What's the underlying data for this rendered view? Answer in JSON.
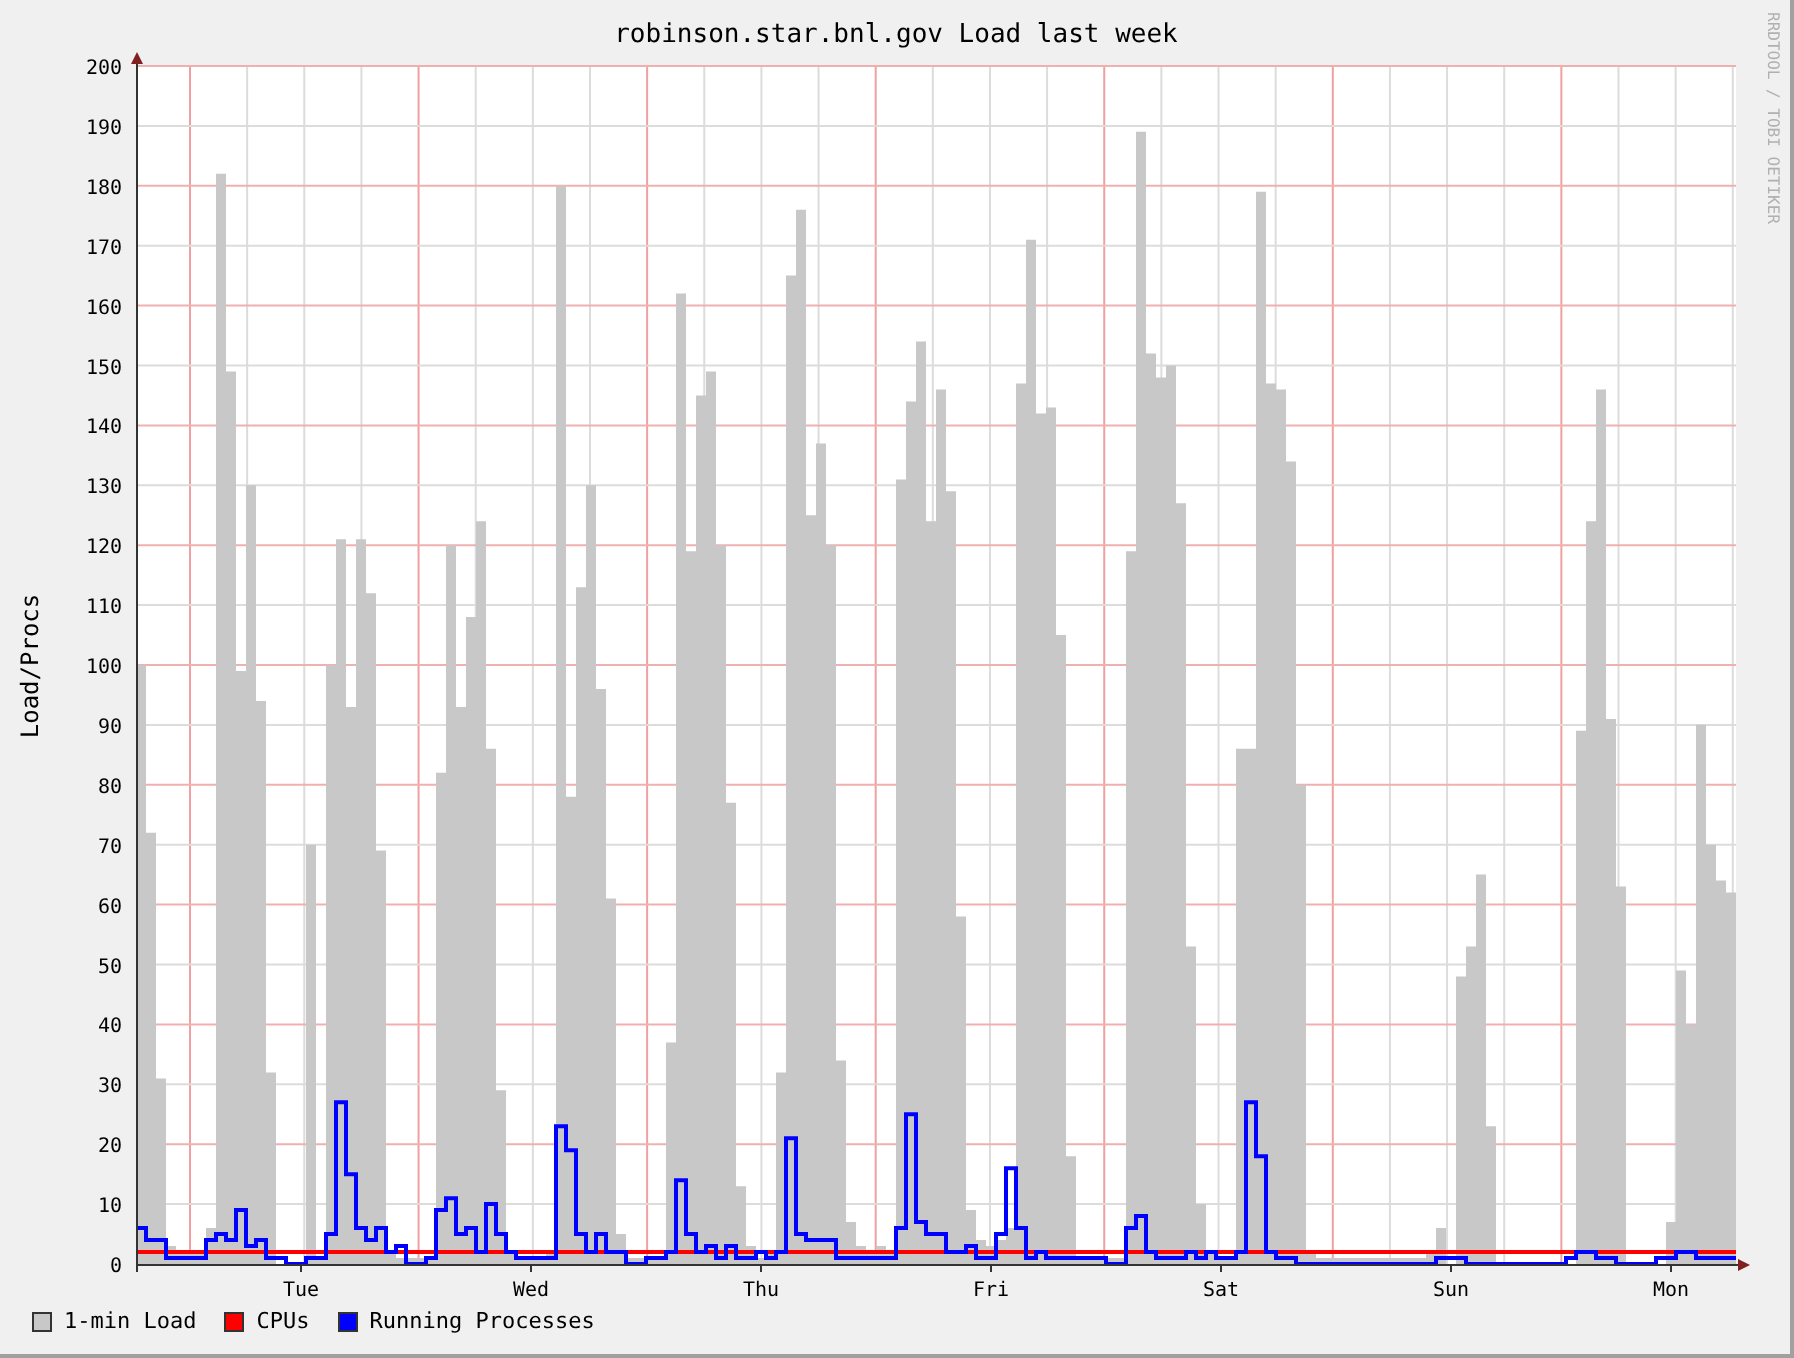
{
  "chart_data": {
    "type": "area",
    "title": "robinson.star.bnl.gov Load last week",
    "ylabel": "Load/Procs",
    "grid": true,
    "categories": [
      null,
      null,
      null,
      null,
      null,
      null,
      null,
      null,
      null,
      null,
      null,
      null,
      null,
      null,
      null,
      null,
      "Tue",
      null,
      null,
      null,
      null,
      null,
      null,
      null,
      null,
      null,
      null,
      null,
      null,
      null,
      null,
      null,
      null,
      null,
      null,
      null,
      null,
      null,
      null,
      "Wed",
      null,
      null,
      null,
      null,
      null,
      null,
      null,
      null,
      null,
      null,
      null,
      null,
      null,
      null,
      null,
      null,
      null,
      null,
      null,
      null,
      null,
      null,
      "Thu",
      null,
      null,
      null,
      null,
      null,
      null,
      null,
      null,
      null,
      null,
      null,
      null,
      null,
      null,
      null,
      null,
      null,
      null,
      null,
      null,
      null,
      null,
      "Fri",
      null,
      null,
      null,
      null,
      null,
      null,
      null,
      null,
      null,
      null,
      null,
      null,
      null,
      null,
      null,
      null,
      null,
      null,
      null,
      null,
      null,
      null,
      "Sat",
      null,
      null,
      null,
      null,
      null,
      null,
      null,
      null,
      null,
      null,
      null,
      null,
      null,
      null,
      null,
      null,
      null,
      null,
      null,
      null,
      null,
      null,
      "Sun",
      null,
      null,
      null,
      null,
      null,
      null,
      null,
      null,
      null,
      null,
      null,
      null,
      null,
      null,
      null,
      null,
      null,
      null,
      null,
      null,
      null,
      "Mon",
      null,
      null,
      null,
      null,
      null,
      null
    ],
    "ylim": [
      0,
      200
    ],
    "yticks": [
      0,
      10,
      20,
      30,
      40,
      50,
      60,
      70,
      80,
      90,
      100,
      110,
      120,
      130,
      140,
      150,
      160,
      170,
      180,
      190,
      200
    ],
    "series": [
      {
        "name": "1-min Load",
        "type": "area",
        "color": "#c8c8c8",
        "values": [
          100,
          72,
          31,
          3,
          2,
          2,
          2,
          6,
          182,
          149,
          99,
          130,
          94,
          32,
          0,
          0,
          0,
          70,
          1,
          100,
          121,
          93,
          121,
          112,
          69,
          2,
          1,
          1,
          1,
          1,
          82,
          120,
          93,
          108,
          124,
          86,
          29,
          2,
          1,
          1,
          1,
          2,
          180,
          78,
          113,
          130,
          96,
          61,
          5,
          1,
          1,
          1,
          1,
          37,
          162,
          119,
          145,
          149,
          120,
          77,
          13,
          3,
          1,
          2,
          32,
          165,
          176,
          125,
          137,
          120,
          34,
          7,
          3,
          2,
          3,
          2,
          131,
          144,
          154,
          124,
          146,
          129,
          58,
          9,
          4,
          3,
          4,
          6,
          147,
          171,
          142,
          143,
          105,
          18,
          1,
          1,
          1,
          1,
          1,
          119,
          189,
          152,
          148,
          150,
          127,
          53,
          10,
          2,
          1,
          1,
          86,
          86,
          179,
          147,
          146,
          134,
          80,
          2,
          1,
          1,
          1,
          1,
          1,
          1,
          1,
          1,
          1,
          1,
          1,
          2,
          6,
          0,
          48,
          53,
          65,
          23,
          0,
          0,
          0,
          0,
          0,
          0,
          0,
          0,
          89,
          124,
          146,
          91,
          63,
          0,
          0,
          0,
          0,
          7,
          49,
          40,
          90,
          70,
          64,
          62
        ]
      },
      {
        "name": "CPUs",
        "type": "line",
        "color": "#ff0000",
        "values": [
          2,
          2,
          2,
          2,
          2,
          2,
          2,
          2,
          2,
          2,
          2,
          2,
          2,
          2,
          2,
          2,
          2,
          2,
          2,
          2,
          2,
          2,
          2,
          2,
          2,
          2,
          2,
          2,
          2,
          2,
          2,
          2,
          2,
          2,
          2,
          2,
          2,
          2,
          2,
          2,
          2,
          2,
          2,
          2,
          2,
          2,
          2,
          2,
          2,
          2,
          2,
          2,
          2,
          2,
          2,
          2,
          2,
          2,
          2,
          2,
          2,
          2,
          2,
          2,
          2,
          2,
          2,
          2,
          2,
          2,
          2,
          2,
          2,
          2,
          2,
          2,
          2,
          2,
          2,
          2,
          2,
          2,
          2,
          2,
          2,
          2,
          2,
          2,
          2,
          2,
          2,
          2,
          2,
          2,
          2,
          2,
          2,
          2,
          2,
          2,
          2,
          2,
          2,
          2,
          2,
          2,
          2,
          2,
          2,
          2,
          2,
          2,
          2,
          2,
          2,
          2,
          2,
          2,
          2,
          2,
          2,
          2,
          2,
          2,
          2,
          2,
          2,
          2,
          2,
          2,
          2,
          2,
          2,
          2,
          2,
          2,
          2,
          2,
          2,
          2,
          2,
          2,
          2,
          2,
          2,
          2,
          2,
          2,
          2,
          2,
          2,
          2,
          2,
          2,
          2,
          2,
          2,
          2,
          2,
          2
        ]
      },
      {
        "name": "Running Processes",
        "type": "line",
        "color": "#0000ff",
        "values": [
          6,
          4,
          4,
          1,
          1,
          1,
          1,
          4,
          5,
          4,
          9,
          3,
          4,
          1,
          1,
          0,
          0,
          1,
          1,
          5,
          27,
          15,
          6,
          4,
          6,
          2,
          3,
          0,
          0,
          1,
          9,
          11,
          5,
          6,
          2,
          10,
          5,
          2,
          1,
          1,
          1,
          1,
          23,
          19,
          5,
          2,
          5,
          2,
          2,
          0,
          0,
          1,
          1,
          2,
          14,
          5,
          2,
          3,
          1,
          3,
          1,
          1,
          2,
          1,
          2,
          21,
          5,
          4,
          4,
          4,
          1,
          1,
          1,
          1,
          1,
          1,
          6,
          25,
          7,
          5,
          5,
          2,
          2,
          3,
          1,
          1,
          5,
          16,
          6,
          1,
          2,
          1,
          1,
          1,
          1,
          1,
          1,
          0,
          0,
          6,
          8,
          2,
          1,
          1,
          1,
          2,
          1,
          2,
          1,
          1,
          2,
          27,
          18,
          2,
          1,
          1,
          0,
          0,
          0,
          0,
          0,
          0,
          0,
          0,
          0,
          0,
          0,
          0,
          0,
          0,
          1,
          1,
          1,
          0,
          0,
          0,
          0,
          0,
          0,
          0,
          0,
          0,
          0,
          1,
          2,
          2,
          1,
          1,
          0,
          0,
          0,
          0,
          1,
          1,
          2,
          2,
          1,
          1,
          1,
          1
        ]
      }
    ]
  },
  "credit": "RRDTOOL / TOBI OETIKER"
}
